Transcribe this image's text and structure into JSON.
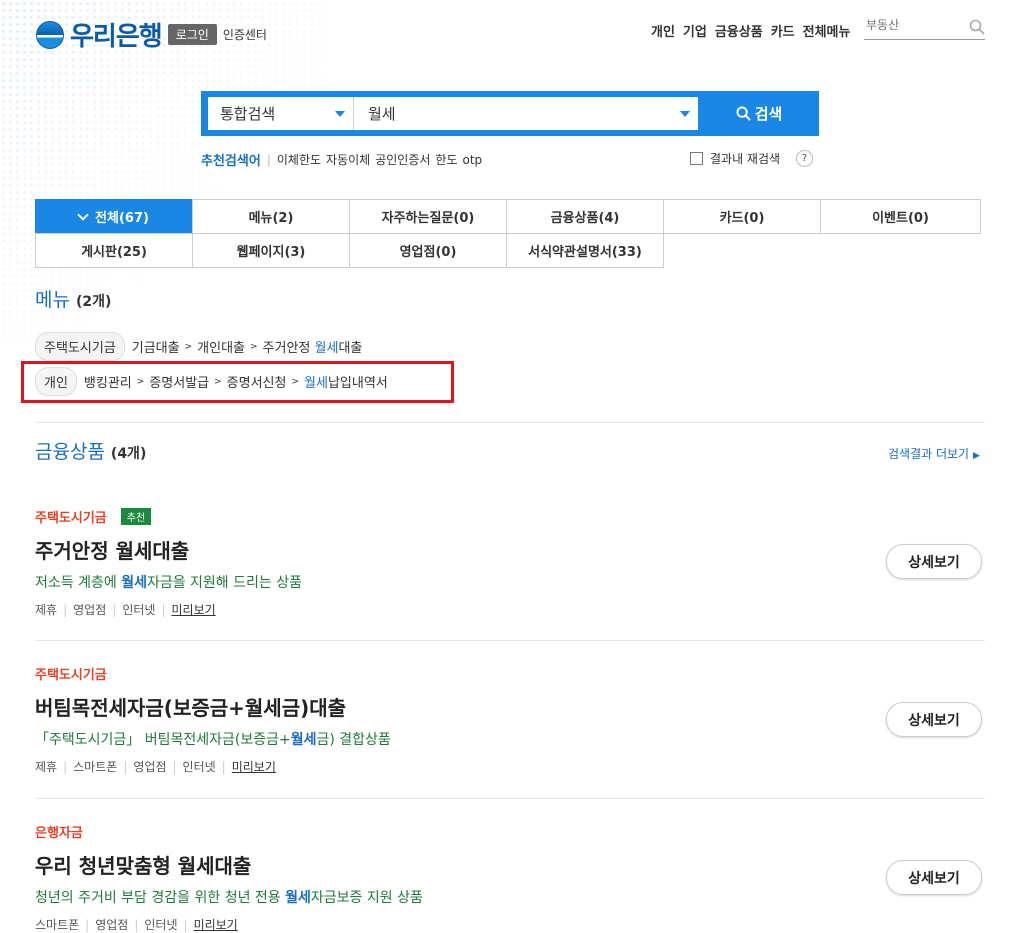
{
  "header": {
    "brand": "우리은행",
    "login_label": "로그인",
    "cert_label": "인증센터",
    "nav": [
      "개인",
      "기업",
      "금융상품",
      "카드",
      "전체메뉴"
    ],
    "search_placeholder": "부동산"
  },
  "search": {
    "scope": "통합검색",
    "query": "월세",
    "button_label": "검색",
    "recommend_title": "추천검색어",
    "recommend_keywords": [
      "이체한도",
      "자동이체",
      "공인인증서",
      "한도",
      "otp"
    ],
    "research_label": "결과내 재검색",
    "help_label": "?"
  },
  "tabs": [
    [
      "전체(67)",
      "메뉴(2)",
      "자주하는질문(0)",
      "금융상품(4)",
      "카드(0)",
      "이벤트(0)"
    ],
    [
      "게시판(25)",
      "웹페이지(3)",
      "영업점(0)",
      "서식약관설명서(33)"
    ]
  ],
  "menu_section": {
    "title": "메뉴",
    "count": "(2개)",
    "paths": [
      {
        "tag": "주택도시기금",
        "steps": [
          "기금대출",
          "개인대출"
        ],
        "last_pre": "주거안정 ",
        "last_hl": "월세",
        "last_post": "대출"
      },
      {
        "tag": "개인",
        "steps": [
          "뱅킹관리",
          "증명서발급",
          "증명서신청"
        ],
        "last_pre": "",
        "last_hl": "월세",
        "last_post": "납입내역서"
      }
    ]
  },
  "product_section": {
    "title": "금융상품",
    "count": "(4개)",
    "more_label": "검색결과 더보기",
    "detail_label": "상세보기",
    "preview_label": "미리보기",
    "products": [
      {
        "category": "주택도시기금",
        "badge": "추천",
        "name": "주거안정 월세대출",
        "desc_pre": "저소득 계층에 ",
        "desc_hl": "월세",
        "desc_post": "자금을 지원해 드리는 상품",
        "tags": [
          "제휴",
          "영업점",
          "인터넷"
        ]
      },
      {
        "category": "주택도시기금",
        "badge": "",
        "name": "버팀목전세자금(보증금+월세금)대출",
        "desc_pre": "「주택도시기금」 버팀목전세자금(보증금+",
        "desc_hl": "월세",
        "desc_post": "금) 결합상품",
        "tags": [
          "제휴",
          "스마트폰",
          "영업점",
          "인터넷"
        ]
      },
      {
        "category": "은행자금",
        "badge": "",
        "name": "우리 청년맞춤형 월세대출",
        "desc_pre": "청년의 주거비 부담 경감을 위한 청년 전용 ",
        "desc_hl": "월세",
        "desc_post": "자금보증 지원 상품",
        "tags": [
          "스마트폰",
          "영업점",
          "인터넷"
        ]
      }
    ]
  },
  "colors": {
    "brand_blue": "#1b87e4",
    "link_blue": "#1b6fc2",
    "category_red": "#e0452a",
    "desc_green": "#1e7a3a",
    "badge_green": "#1c8a3c",
    "highlight_box": "#e1141b"
  }
}
